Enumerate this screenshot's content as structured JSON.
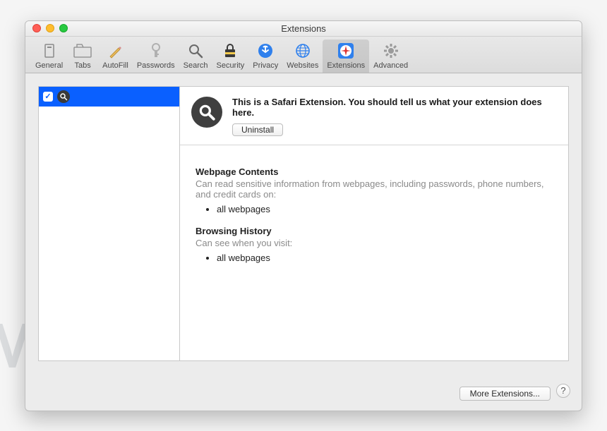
{
  "window_title": "Extensions",
  "toolbar": {
    "items": [
      {
        "label": "General"
      },
      {
        "label": "Tabs"
      },
      {
        "label": "AutoFill"
      },
      {
        "label": "Passwords"
      },
      {
        "label": "Search"
      },
      {
        "label": "Security"
      },
      {
        "label": "Privacy"
      },
      {
        "label": "Websites"
      },
      {
        "label": "Extensions"
      },
      {
        "label": "Advanced"
      }
    ]
  },
  "sidebar": {
    "ext_checkbox": "✓"
  },
  "detail": {
    "description": "This is a Safari Extension. You should tell us what your extension does here.",
    "uninstall_label": "Uninstall",
    "perm1_title": "Webpage Contents",
    "perm1_desc": "Can read sensitive information from webpages, including passwords, phone numbers, and credit cards on:",
    "perm1_item": "all webpages",
    "perm2_title": "Browsing History",
    "perm2_desc": "Can see when you visit:",
    "perm2_item": "all webpages"
  },
  "footer": {
    "more_label": "More Extensions...",
    "help_label": "?"
  },
  "watermark": "MALWARETIPS"
}
